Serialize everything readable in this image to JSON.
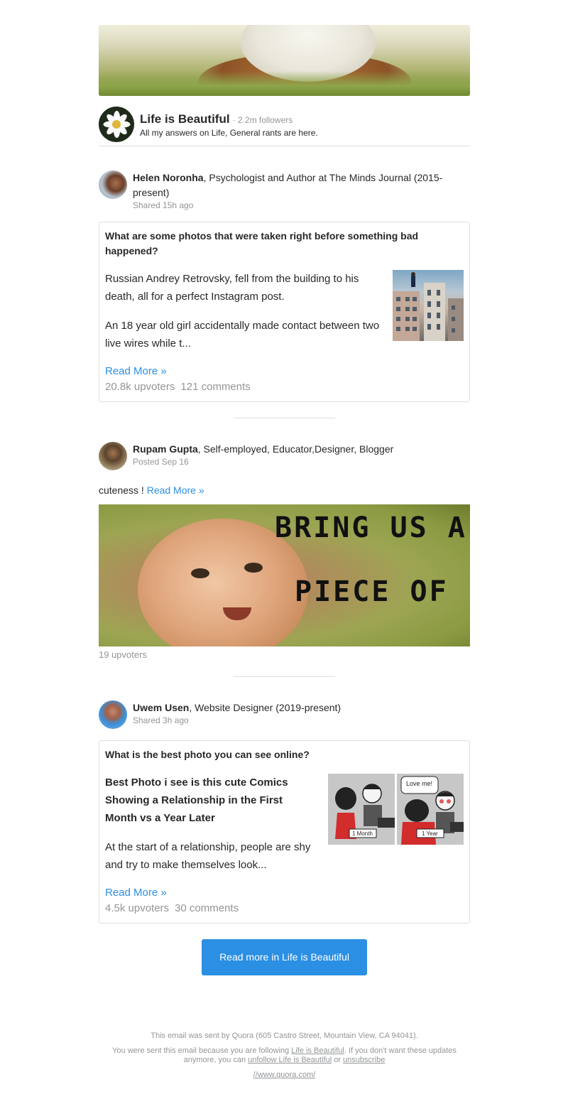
{
  "space": {
    "name": "Life is Beautiful",
    "followers": "· 2.2m followers",
    "description": "All my answers on Life, General rants are here."
  },
  "items": [
    {
      "author": "Helen Noronha",
      "credential": ", Psychologist and Author at The Minds Journal (2015-present)",
      "meta": "Shared 15h ago",
      "question": "What are some photos that were taken right before something bad happened?",
      "para1": "Russian Andrey Retrovsky, fell from the building to his death, all for a perfect Instagram post.",
      "para2": "An 18 year old girl accidentally made contact between two live wires while t...",
      "read_more": "Read More »",
      "upvoters": "20.8k upvoters",
      "comments": "121 comments"
    },
    {
      "author": "Rupam Gupta",
      "credential": ", Self-employed, Educator,Designer, Blogger",
      "meta": "Posted Sep 16",
      "text": "cuteness ! ",
      "read_more": "Read More »",
      "image_text_1": "BRING US A",
      "image_text_2": "PIECE OF",
      "upvoters": "19 upvoters"
    },
    {
      "author": "Uwem Usen",
      "credential": ", Website Designer (2019-present)",
      "meta": "Shared 3h ago",
      "question": "What is the best photo you can see online?",
      "para1": "Best Photo i see is this cute Comics Showing a Relationship in the First Month vs a Year Later",
      "para2": "At the start of a relationship, people are shy and try to make themselves look...",
      "comic_bubble": "Love me!",
      "comic_label_1": "1 Month",
      "comic_label_2": "1 Year",
      "read_more": "Read More »",
      "upvoters": "4.5k upvoters",
      "comments": "30 comments"
    }
  ],
  "cta": {
    "label": "Read more in Life is Beautiful",
    "color": "#2b8fe3"
  },
  "footer": {
    "line1": "This email was sent by Quora (605 Castro Street, Mountain View, CA 94041).",
    "line2_a": "You were sent this email because you are following ",
    "line2_link": "Life is Beautiful",
    "line2_b": ". If you don't want these updates anymore, you can ",
    "unfollow": "unfollow Life is Beautiful",
    "line2_c": " or ",
    "unsubscribe": "unsubscribe",
    "site": "//www.quora.com/"
  }
}
